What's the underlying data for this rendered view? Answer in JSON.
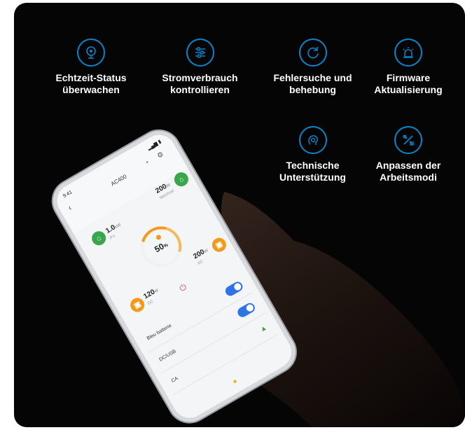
{
  "features": [
    {
      "icon": "monitor-icon",
      "label": "Echtzeit-Status\nüberwachen"
    },
    {
      "icon": "sliders-icon",
      "label": "Stromverbrauch\nkontrollieren"
    },
    {
      "icon": "refresh-icon",
      "label": "Fehlersuche und\nbehebung"
    },
    {
      "icon": "alarm-light-icon",
      "label": "Firmware\nAktualisierung"
    },
    {
      "icon": "support-icon",
      "label": "Technische\nUnterstützung"
    },
    {
      "icon": "tools-icon",
      "label": "Anpassen der\nArbeitsmodi"
    }
  ],
  "colors": {
    "accent": "#0b84c9",
    "background": "#050505",
    "orange": "#f39a1d",
    "green": "#3aa64b",
    "toggle": "#2f74e6"
  },
  "phone": {
    "status_time": "9:41",
    "status_right": "▂▄▆ ▮",
    "title": "AC400",
    "back": "‹",
    "header_icons": "◔ ⚙",
    "top_right_value": "200",
    "top_right_unit": "W",
    "top_right_sub": "Wechsel",
    "solar_value": "1.0",
    "solar_unit": "kW",
    "solar_sub": "PV",
    "battery_pct": "50",
    "battery_unit": "%",
    "dc_value": "120",
    "dc_unit": "W",
    "dc_sub": "DC",
    "ac_value": "200",
    "ac_unit": "W",
    "ac_sub": "AC",
    "power_symbol": "⏻",
    "rows": [
      {
        "label": "Bleu batterie"
      },
      {
        "label": "DC/USB"
      },
      {
        "label": "CA"
      }
    ],
    "bottom_icon": "●"
  }
}
